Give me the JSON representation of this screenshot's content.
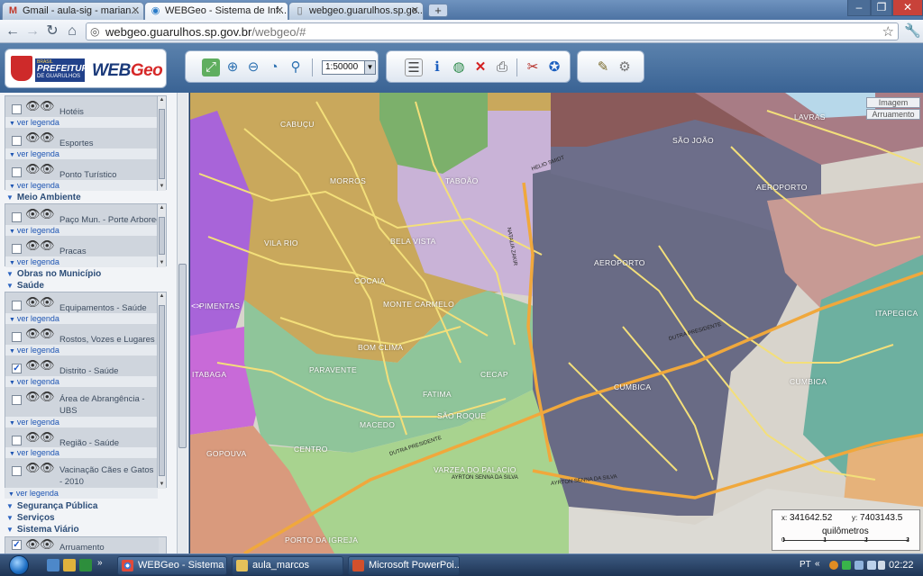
{
  "browser": {
    "tabs": [
      {
        "label": "Gmail - aula-sig - marian...",
        "icon": "gmail-icon"
      },
      {
        "label": "WEBGeo - Sistema de Inf...",
        "icon": "webgeo-globe-icon"
      },
      {
        "label": "webgeo.guarulhos.sp.go...",
        "icon": "page-icon"
      }
    ],
    "new_tab": "+",
    "url_host": "webgeo.guarulhos.sp.gov.br",
    "url_path": "/webgeo/#",
    "window_controls": [
      "–",
      "❐",
      "✕"
    ]
  },
  "app": {
    "logo_top_text": "BRASIL",
    "logo_main": "PREFEITURA",
    "logo_sub": "DE GUARULHOS",
    "logo_brand_a": "WEB",
    "logo_brand_b": "Geo",
    "scale_value": "1:50000",
    "tools": [
      "zoom-extent-icon",
      "zoom-in-icon",
      "zoom-out-icon",
      "zoom-previous-icon",
      "zoom-next-icon",
      "layers-list-icon",
      "info-icon",
      "globe-icon",
      "clear-icon",
      "print-icon",
      "tools-icon",
      "search-globe-icon",
      "edit-icon",
      "settings-icon"
    ]
  },
  "panel": {
    "legend_link": "ver legenda",
    "groups": [
      {
        "layers": [
          {
            "name": "Hotéis",
            "checked": false
          },
          {
            "name": "Esportes",
            "checked": false
          },
          {
            "name": "Ponto Turístico",
            "checked": false
          }
        ]
      },
      {
        "title": "Meio Ambiente",
        "layers": [
          {
            "name": "Paço Mun. - Porte Arboreo",
            "checked": false
          },
          {
            "name": "Pracas",
            "checked": false
          }
        ]
      },
      {
        "title": "Obras no Município"
      },
      {
        "title": "Saúde",
        "layers": [
          {
            "name": "Equipamentos - Saúde",
            "checked": false
          },
          {
            "name": "Rostos, Vozes e Lugares",
            "checked": false
          },
          {
            "name": "Distrito - Saúde",
            "checked": true
          },
          {
            "name": "Área de Abrangência - UBS",
            "checked": false
          },
          {
            "name": "Região - Saúde",
            "checked": false
          },
          {
            "name": "Vacinação Cães e Gatos - 2010",
            "checked": false
          }
        ]
      },
      {
        "title": "Segurança Pública"
      },
      {
        "title": "Serviços"
      },
      {
        "title": "Sistema Viário",
        "layers": [
          {
            "name": "Arruamento",
            "checked": true
          }
        ]
      }
    ]
  },
  "map": {
    "map_type_buttons": [
      "Imagem",
      "Arruamento"
    ],
    "region_labels": [
      "CABUÇU",
      "MORROS",
      "TABOÃO",
      "VILA RIO",
      "BELA VISTA",
      "COCAIA",
      "MONTE CARMELO",
      "PIMENTAS",
      "BOM CLIMA",
      "PARAVENTE",
      "CECAP",
      "FATIMA",
      "MACEDO",
      "SÃO ROQUE",
      "CENTRO",
      "GOPOUVA",
      "VARZEA DO PALACIO",
      "PORTO DA IGREJA",
      "AEROPORTO",
      "AEROPORTO",
      "SÃO JOÃO",
      "LAVRAS",
      "CUMBICA",
      "CUMBICA",
      "ITAPEGICA",
      "ITABAGA"
    ],
    "road_labels": [
      "DUTRA PRESIDENTE",
      "AYRTON SENNA DA SILVA",
      "HELIO SMIDT",
      "NATALIA ZAKIR"
    ],
    "coord_x_label": "x:",
    "coord_x": "341642.52",
    "coord_y_label": "y:",
    "coord_y": "7403143.5",
    "scale_unit": "quilômetros",
    "scale_ticks": [
      "0",
      "1",
      "2",
      "3"
    ],
    "colors": {
      "airport": "#696b85",
      "yellow_zone": "#c9a85c",
      "green_zone": "#8fc59a",
      "lilac_zone": "#c9b3d7",
      "purple_zone": "#a864d9",
      "brown_zone": "#8a5a5a",
      "teal_zone": "#6db0a0",
      "roads": "#f3df7a",
      "highway": "#f0a83c"
    }
  },
  "taskbar": {
    "items": [
      {
        "label": "WEBGeo - Sistema d...",
        "icon": "chrome-icon"
      },
      {
        "label": "aula_marcos",
        "icon": "folder-icon"
      },
      {
        "label": "Microsoft PowerPoi...",
        "icon": "powerpoint-icon"
      }
    ],
    "lang": "PT",
    "clock": "02:22"
  }
}
